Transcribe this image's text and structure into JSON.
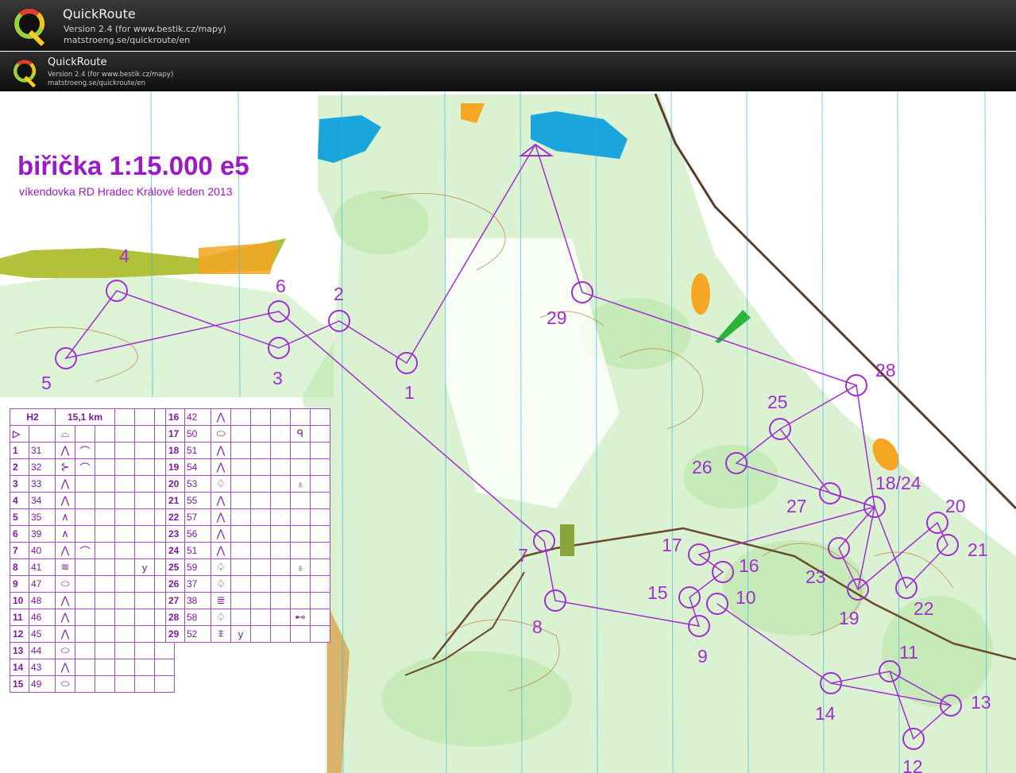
{
  "header_primary": {
    "app_name": "QuickRoute",
    "version_line": "Version 2.4  (for www.bestik.cz/mapy)",
    "url": "matstroeng.se/quickroute/en"
  },
  "header_secondary": {
    "app_name": "QuickRoute",
    "version_line": "Version 2.4  (for www.bestik.cz/mapy)",
    "url": "matstroeng.se/quickroute/en"
  },
  "map": {
    "title": "biřička 1:15.000 e5",
    "subtitle": "víkendovka RD Hradec Králové leden 2013",
    "colors": {
      "course": "#a02fd0",
      "water": "#1aa6dc",
      "green": "#aee39b",
      "contour": "#c07a3c",
      "open": "#f5a623",
      "magnetic_north": "#3fb8e6"
    },
    "control_labels": [
      "1",
      "2",
      "3",
      "4",
      "5",
      "6",
      "7",
      "8",
      "9",
      "10",
      "11",
      "12",
      "13",
      "14",
      "15",
      "16",
      "17",
      "18/24",
      "19",
      "20",
      "21",
      "22",
      "23",
      "25",
      "26",
      "27",
      "28",
      "29"
    ]
  },
  "description_table": {
    "class_label": "H2",
    "length_label": "15,1 km",
    "left_rows": [
      {
        "num": "1",
        "code": "31",
        "feature": "⋀",
        "detail": "⌒"
      },
      {
        "num": "2",
        "code": "32",
        "feature": "⊱",
        "detail": "⌒"
      },
      {
        "num": "3",
        "code": "33",
        "feature": "⋀",
        "detail": ""
      },
      {
        "num": "4",
        "code": "34",
        "feature": "⋀",
        "detail": ""
      },
      {
        "num": "5",
        "code": "35",
        "feature": "∧",
        "detail": ""
      },
      {
        "num": "6",
        "code": "39",
        "feature": "∧",
        "detail": ""
      },
      {
        "num": "7",
        "code": "40",
        "feature": "⋀",
        "detail": "⌒"
      },
      {
        "num": "8",
        "code": "41",
        "feature": "≋",
        "detail": "",
        "extra": "y"
      },
      {
        "num": "9",
        "code": "47",
        "feature": "⬭",
        "detail": ""
      },
      {
        "num": "10",
        "code": "48",
        "feature": "⋀",
        "detail": ""
      },
      {
        "num": "11",
        "code": "46",
        "feature": "⋀",
        "detail": ""
      },
      {
        "num": "12",
        "code": "45",
        "feature": "⋀",
        "detail": ""
      },
      {
        "num": "13",
        "code": "44",
        "feature": "⬭",
        "detail": ""
      },
      {
        "num": "14",
        "code": "43",
        "feature": "⋀",
        "detail": ""
      },
      {
        "num": "15",
        "code": "49",
        "feature": "⬭",
        "detail": ""
      }
    ],
    "right_rows": [
      {
        "num": "16",
        "code": "42",
        "feature": "⋀",
        "detail": ""
      },
      {
        "num": "17",
        "code": "50",
        "feature": "⬭",
        "detail": "",
        "extra": "ᑫ"
      },
      {
        "num": "18",
        "code": "51",
        "feature": "⋀",
        "detail": ""
      },
      {
        "num": "19",
        "code": "54",
        "feature": "⋀",
        "detail": ""
      },
      {
        "num": "20",
        "code": "53",
        "feature": "♤",
        "detail": "",
        "extra": "♁"
      },
      {
        "num": "21",
        "code": "55",
        "feature": "⋀",
        "detail": ""
      },
      {
        "num": "22",
        "code": "57",
        "feature": "⋀",
        "detail": ""
      },
      {
        "num": "23",
        "code": "56",
        "feature": "⋀",
        "detail": ""
      },
      {
        "num": "24",
        "code": "51",
        "feature": "⋀",
        "detail": ""
      },
      {
        "num": "25",
        "code": "59",
        "feature": "♤",
        "detail": "",
        "extra": "♁"
      },
      {
        "num": "26",
        "code": "37",
        "feature": "♤",
        "detail": ""
      },
      {
        "num": "27",
        "code": "38",
        "feature": "≣",
        "detail": ""
      },
      {
        "num": "28",
        "code": "58",
        "feature": "♤",
        "detail": "",
        "extra": "⊷"
      },
      {
        "num": "29",
        "code": "52",
        "feature": "⩨",
        "detail": "y"
      }
    ]
  }
}
